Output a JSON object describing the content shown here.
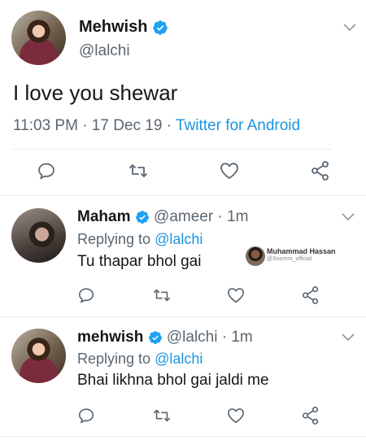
{
  "main_tweet": {
    "name": "Mehwish",
    "handle": "@lalchi",
    "text": "I love you shewar",
    "time": "11:03 PM · 17 Dec 19 · ",
    "source": "Twitter for Android"
  },
  "replies": [
    {
      "name": "Maham",
      "handle_time": "@ameer · 1m",
      "replying_prefix": "Replying to ",
      "replying_to": "@lalchi",
      "text": "Tu thapar bhol gai",
      "quoted_name": "Muhammad Hassan",
      "quoted_handle": "@Soomro_official"
    },
    {
      "name": "mehwish",
      "handle_time": "@lalchi · 1m",
      "replying_prefix": "Replying to ",
      "replying_to": "@lalchi",
      "text": "Bhai likhna bhol gai jaldi me"
    }
  ],
  "colors": {
    "accent": "#1b95e0",
    "muted": "#5b6670",
    "verified": "#1da1f2"
  },
  "icons": [
    "reply-icon",
    "retweet-icon",
    "like-icon",
    "share-icon",
    "verified-badge-icon",
    "chevron-down-icon"
  ]
}
